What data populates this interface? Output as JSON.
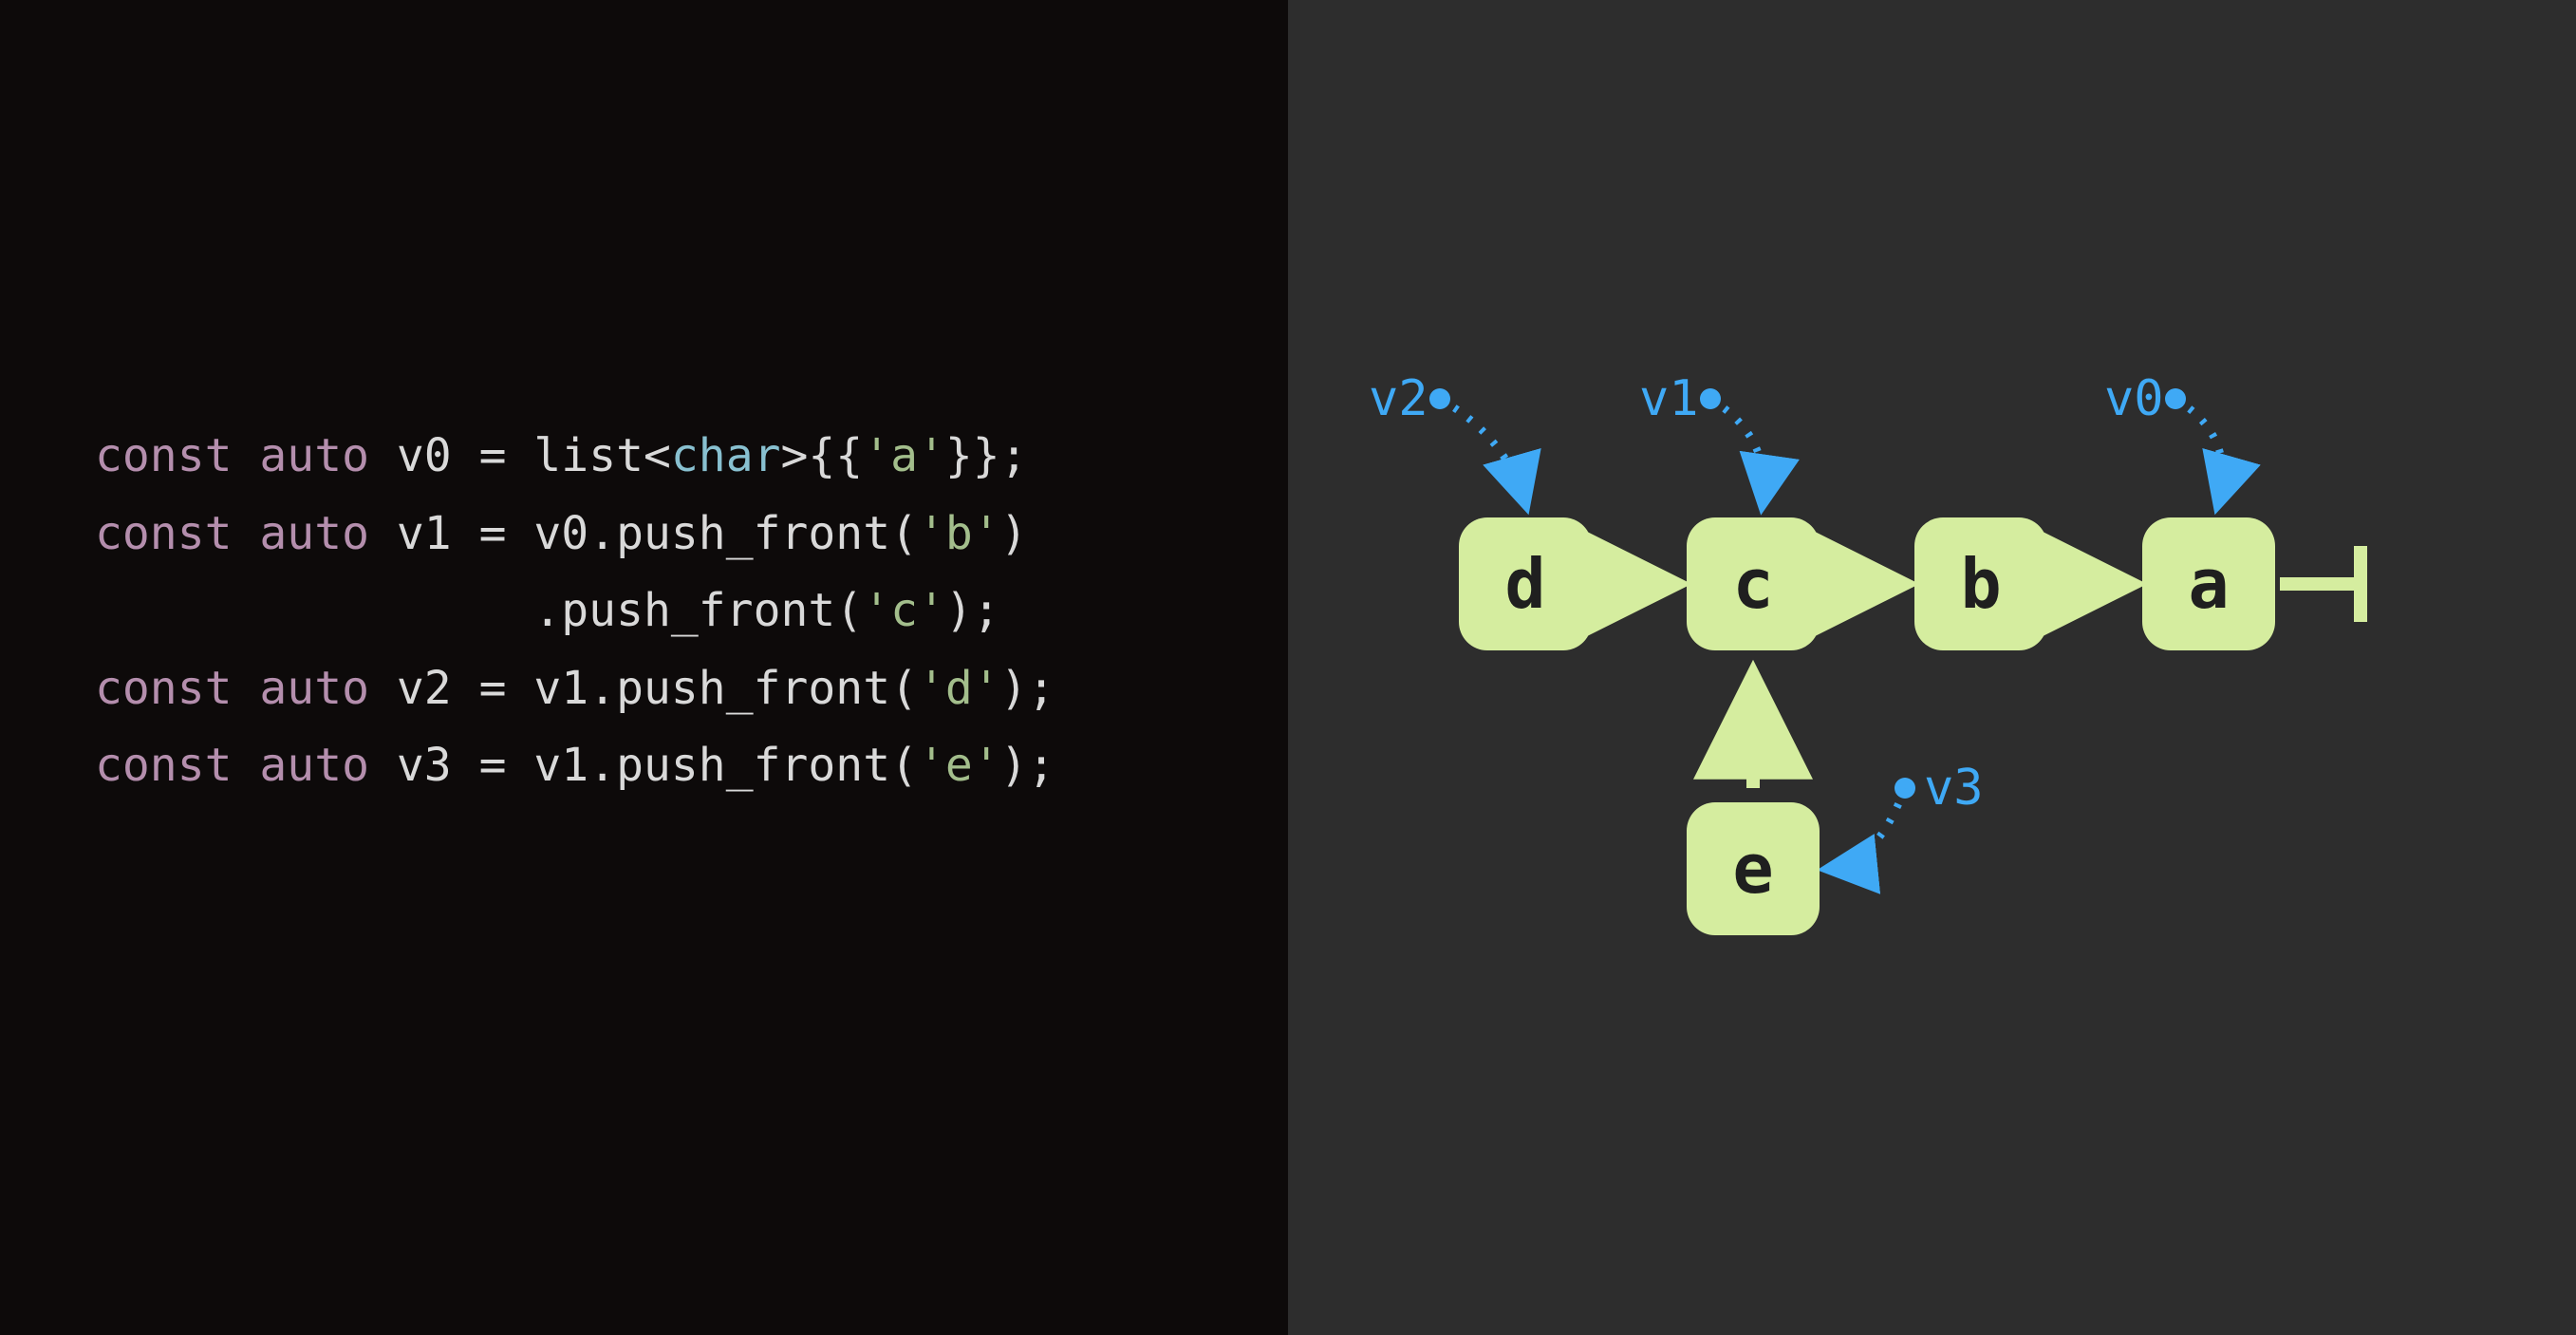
{
  "code": {
    "lines": [
      {
        "const": "const",
        "auto": "auto",
        "var": "v0",
        "eq": " = ",
        "rhs_pre": "list<",
        "type": "char",
        "rhs_mid": ">{{",
        "lit": "'a'",
        "rhs_post": "}};"
      },
      {
        "const": "const",
        "auto": "auto",
        "var": "v1",
        "eq": " = ",
        "obj": "v0",
        "dot": ".",
        "fn": "push_front",
        "lp": "(",
        "lit": "'b'",
        "rp": ")"
      },
      {
        "indent": "                ",
        "dot": ".",
        "fn": "push_front",
        "lp": "(",
        "lit": "'c'",
        "rp": ");"
      },
      {
        "const": "const",
        "auto": "auto",
        "var": "v2",
        "eq": " = ",
        "obj": "v1",
        "dot": ".",
        "fn": "push_front",
        "lp": "(",
        "lit": "'d'",
        "rp": ");"
      },
      {
        "const": "const",
        "auto": "auto",
        "var": "v3",
        "eq": " = ",
        "obj": "v1",
        "dot": ".",
        "fn": "push_front",
        "lp": "(",
        "lit": "'e'",
        "rp": ");"
      }
    ]
  },
  "diagram": {
    "nodes": {
      "d": "d",
      "c": "c",
      "b": "b",
      "a": "a",
      "e": "e"
    },
    "labels": {
      "v2": "v2",
      "v1": "v1",
      "v0": "v0",
      "v3": "v3"
    },
    "colors": {
      "node_bg": "#d5ed9f",
      "node_fg": "#1f1f1f",
      "arrow": "#d5ed9f",
      "pointer": "#3fa9f5",
      "bg_left": "#0d0a0a",
      "bg_right": "#2d2d2d"
    }
  }
}
